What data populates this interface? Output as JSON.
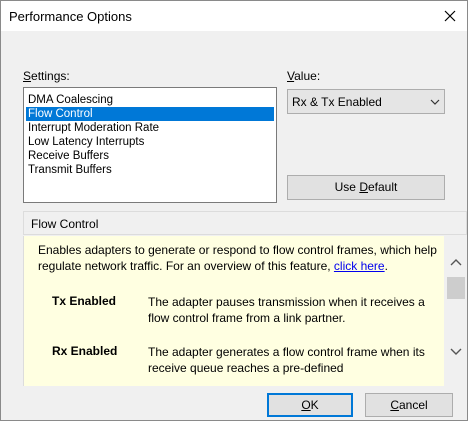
{
  "window": {
    "title": "Performance Options"
  },
  "settings": {
    "label_prefix": "",
    "label_mnemonic": "S",
    "label_rest": "ettings:",
    "items": [
      "DMA Coalescing",
      "Flow Control",
      "Interrupt Moderation Rate",
      "Low Latency Interrupts",
      "Receive Buffers",
      "Transmit Buffers"
    ],
    "selected": "Flow Control"
  },
  "value": {
    "label_mnemonic": "V",
    "label_rest": "alue:",
    "selected": "Rx & Tx Enabled"
  },
  "use_default": {
    "prefix": "Use ",
    "mnemonic": "D",
    "rest": "efault"
  },
  "description": {
    "header": "Flow Control",
    "para_text": "Enables adapters to generate or respond to flow control frames, which help regulate network traffic. For an overview of this feature, ",
    "link": "click here",
    "para_end": ".",
    "terms": [
      {
        "name": "Tx Enabled",
        "desc": "The adapter pauses transmission when it receives a flow control frame from a link partner."
      },
      {
        "name": "Rx Enabled",
        "desc": "The adapter generates a flow control frame when its receive queue reaches a pre-defined"
      }
    ]
  },
  "buttons": {
    "ok": {
      "mnemonic": "O",
      "rest": "K"
    },
    "cancel": {
      "mnemonic": "C",
      "rest": "ancel"
    }
  },
  "colors": {
    "selection": "#0078d7",
    "tooltip_bg": "#ffffe1",
    "link": "#0000ee"
  }
}
